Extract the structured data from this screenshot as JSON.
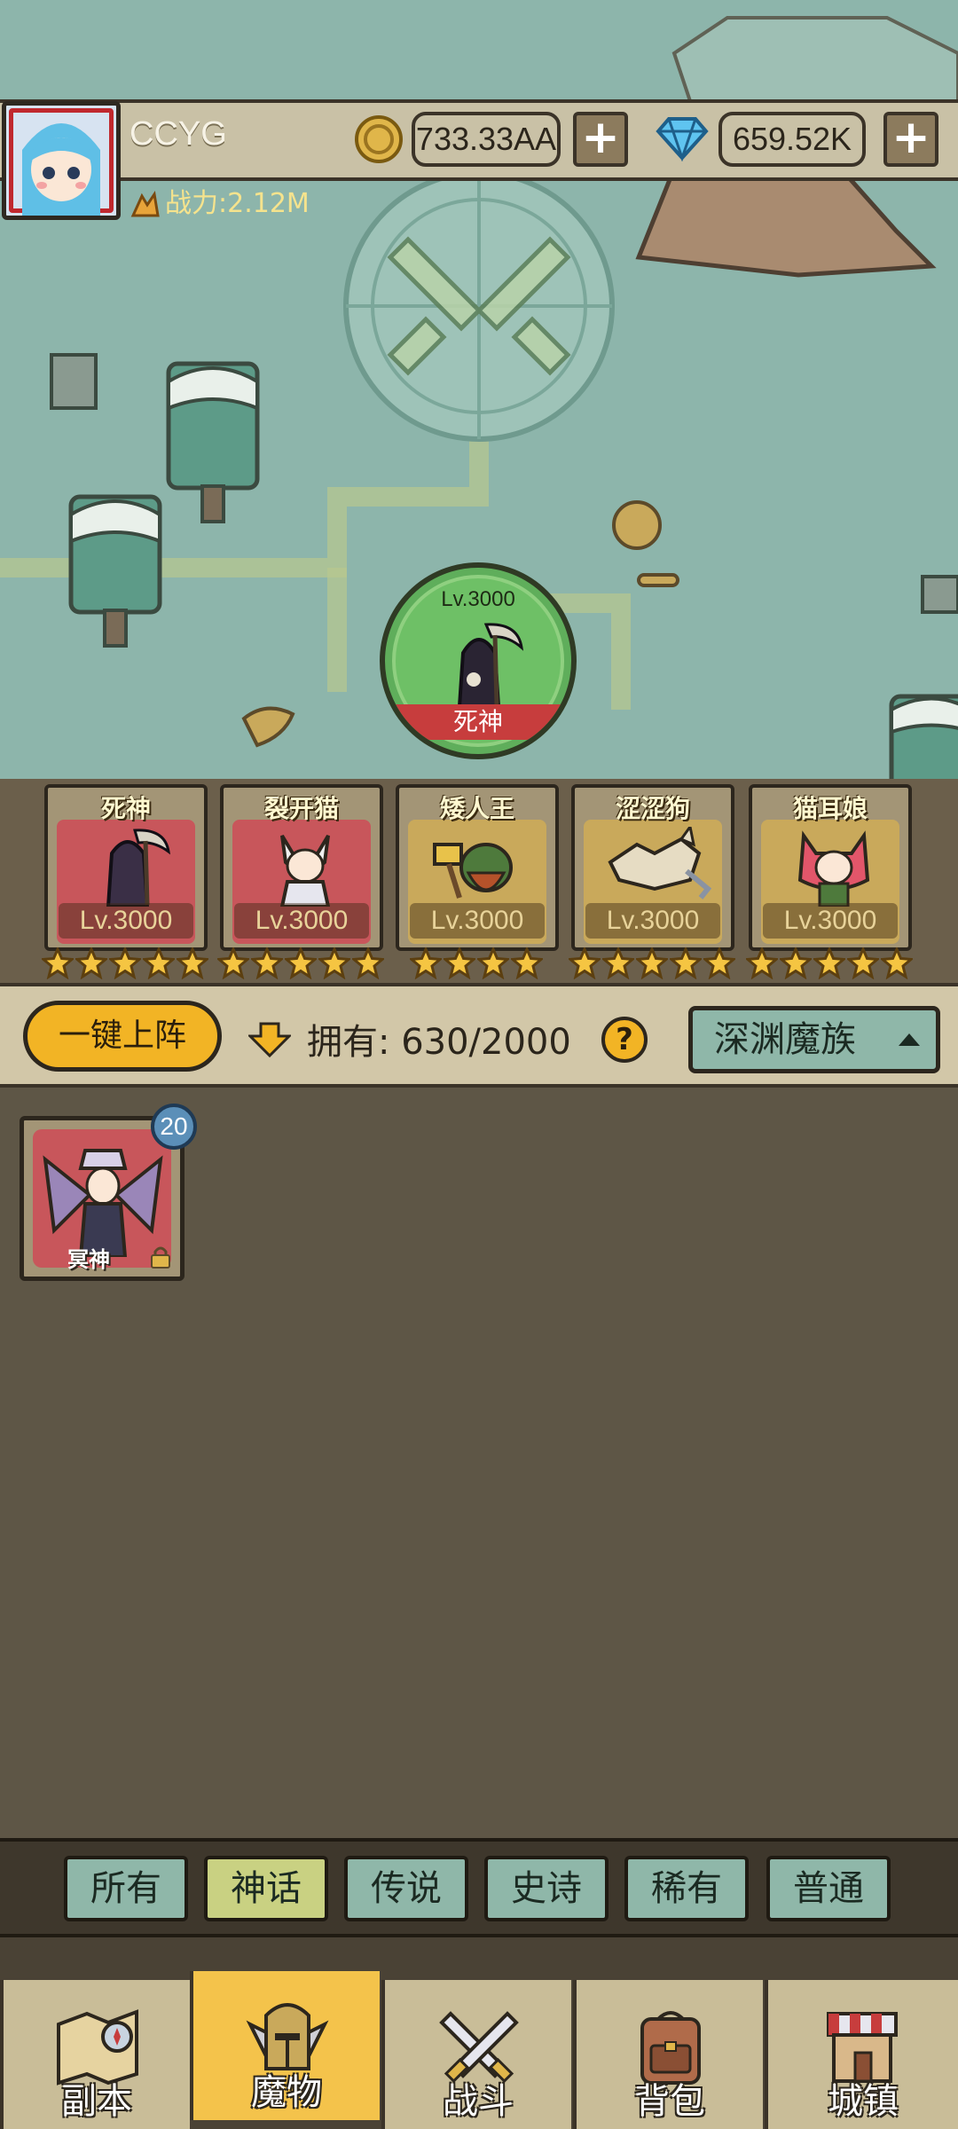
{
  "player": {
    "name": "CCYG",
    "power": "战力:2.12M"
  },
  "resources": {
    "gold": "733.33AA",
    "gems": "659.52K",
    "plus": "+"
  },
  "active_monster": {
    "level": "Lv.3000",
    "name": "死神"
  },
  "team": [
    {
      "name": "死神",
      "level": "Lv.3000",
      "stars": 5,
      "bg": "#c8565b"
    },
    {
      "name": "裂开猫",
      "level": "Lv.3000",
      "stars": 5,
      "bg": "#c8565b"
    },
    {
      "name": "矮人王",
      "level": "Lv.3000",
      "stars": 4,
      "bg": "#c9a95b"
    },
    {
      "name": "涩涩狗",
      "level": "Lv.3000",
      "stars": 5,
      "bg": "#c9a95b"
    },
    {
      "name": "猫耳娘",
      "level": "Lv.3000",
      "stars": 5,
      "bg": "#c9a95b"
    }
  ],
  "owned_bar": {
    "deploy_label": "一键上阵",
    "owned_label": "拥有:",
    "owned_count": "630/2000",
    "help": "?",
    "faction": "深渊魔族"
  },
  "collection": [
    {
      "name": "冥神",
      "count": "20",
      "locked": true
    }
  ],
  "filters": [
    {
      "label": "所有",
      "active": false
    },
    {
      "label": "神话",
      "active": true
    },
    {
      "label": "传说",
      "active": false
    },
    {
      "label": "史诗",
      "active": false
    },
    {
      "label": "稀有",
      "active": false
    },
    {
      "label": "普通",
      "active": false
    }
  ],
  "nav": [
    {
      "label": "副本",
      "icon": "map-scroll-icon",
      "active": false
    },
    {
      "label": "魔物",
      "icon": "knight-helmet-icon",
      "active": true
    },
    {
      "label": "战斗",
      "icon": "crossed-swords-icon",
      "active": false
    },
    {
      "label": "背包",
      "icon": "backpack-icon",
      "active": false
    },
    {
      "label": "城镇",
      "icon": "shop-house-icon",
      "active": false
    }
  ],
  "colors": {
    "accent": "#f2b425",
    "mythic": "#c8565b",
    "legend": "#c9a95b",
    "teal": "#8fb7a9"
  }
}
